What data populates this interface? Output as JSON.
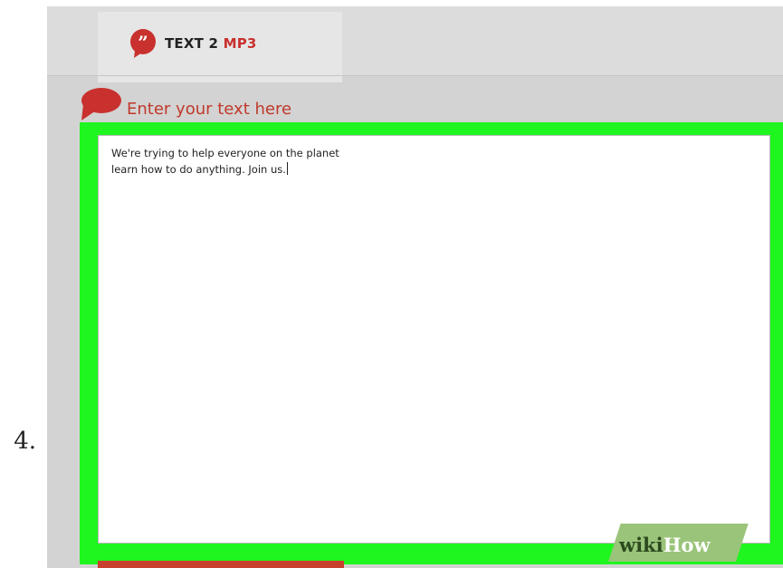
{
  "step": {
    "number": "4."
  },
  "app": {
    "logo_part1": "TEXT 2",
    "logo_part2": "MP3",
    "logo_icon": "quote-bubble-icon"
  },
  "editor": {
    "heading": "Enter your text here",
    "heading_icon": "speech-bubble-icon",
    "text": "We're trying to help everyone on the planet\nlearn how to do anything. Join us.",
    "highlight_color": "#1ff51f"
  },
  "watermark": {
    "part1": "wiki",
    "part2": "How"
  },
  "colors": {
    "accent": "#c8312e",
    "background": "#d3d3d3"
  }
}
